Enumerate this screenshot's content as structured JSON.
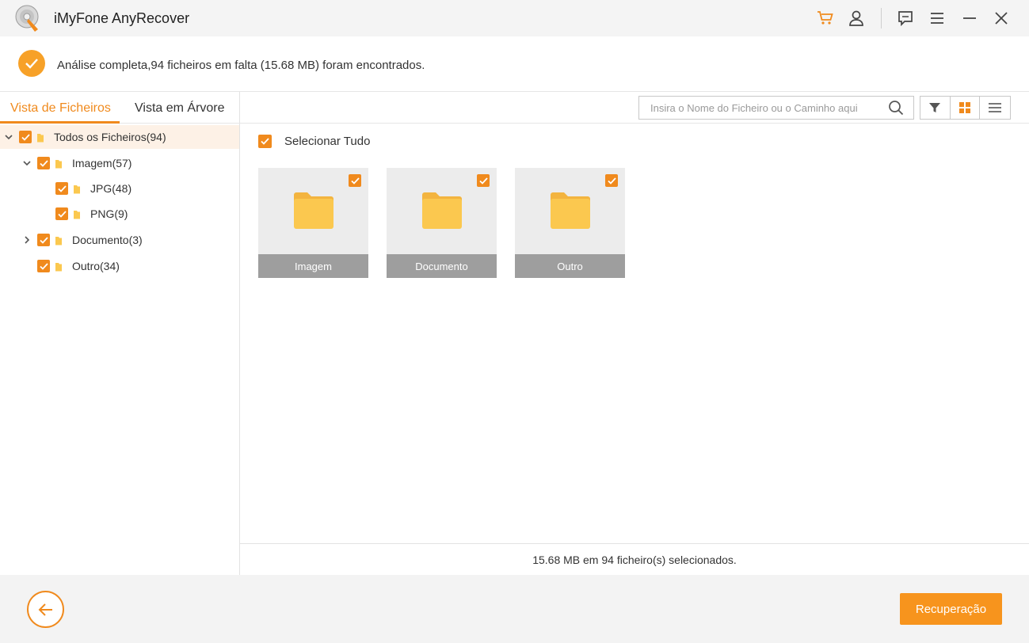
{
  "window": {
    "title": "iMyFone AnyRecover",
    "icons": [
      "cart-icon",
      "user-icon",
      "feedback-icon",
      "menu-icon",
      "minimize-icon",
      "close-icon"
    ]
  },
  "status": {
    "message": "Análise completa,94 ficheiros em falta (15.68 MB) foram encontrados."
  },
  "left_panel": {
    "tabs": [
      {
        "label": "Vista de Ficheiros",
        "active": true
      },
      {
        "label": "Vista em Árvore",
        "active": false
      }
    ],
    "tree": [
      {
        "label": "Todos os Ficheiros(94)",
        "checked": true,
        "expanded": true
      },
      {
        "label": "Imagem(57)",
        "checked": true,
        "expanded": true
      },
      {
        "label": "JPG(48)",
        "checked": true
      },
      {
        "label": "PNG(9)",
        "checked": true
      },
      {
        "label": "Documento(3)",
        "checked": true,
        "expanded": false
      },
      {
        "label": "Outro(34)",
        "checked": true
      }
    ]
  },
  "toolbar": {
    "search_placeholder": "Insira o Nome do Ficheiro ou o Caminho aqui",
    "search_value": "",
    "view_mode": "grid"
  },
  "main": {
    "select_all_label": "Selecionar Tudo",
    "select_all_checked": true,
    "cards": [
      {
        "label": "Imagem",
        "checked": true
      },
      {
        "label": "Documento",
        "checked": true
      },
      {
        "label": "Outro",
        "checked": true
      }
    ],
    "summary": "15.68 MB em 94 ficheiro(s) selecionados."
  },
  "bottom": {
    "recover_label": "Recuperação"
  },
  "colors": {
    "accent": "#f08a1d",
    "button": "#f7941d",
    "folder": "#fbc84f"
  }
}
